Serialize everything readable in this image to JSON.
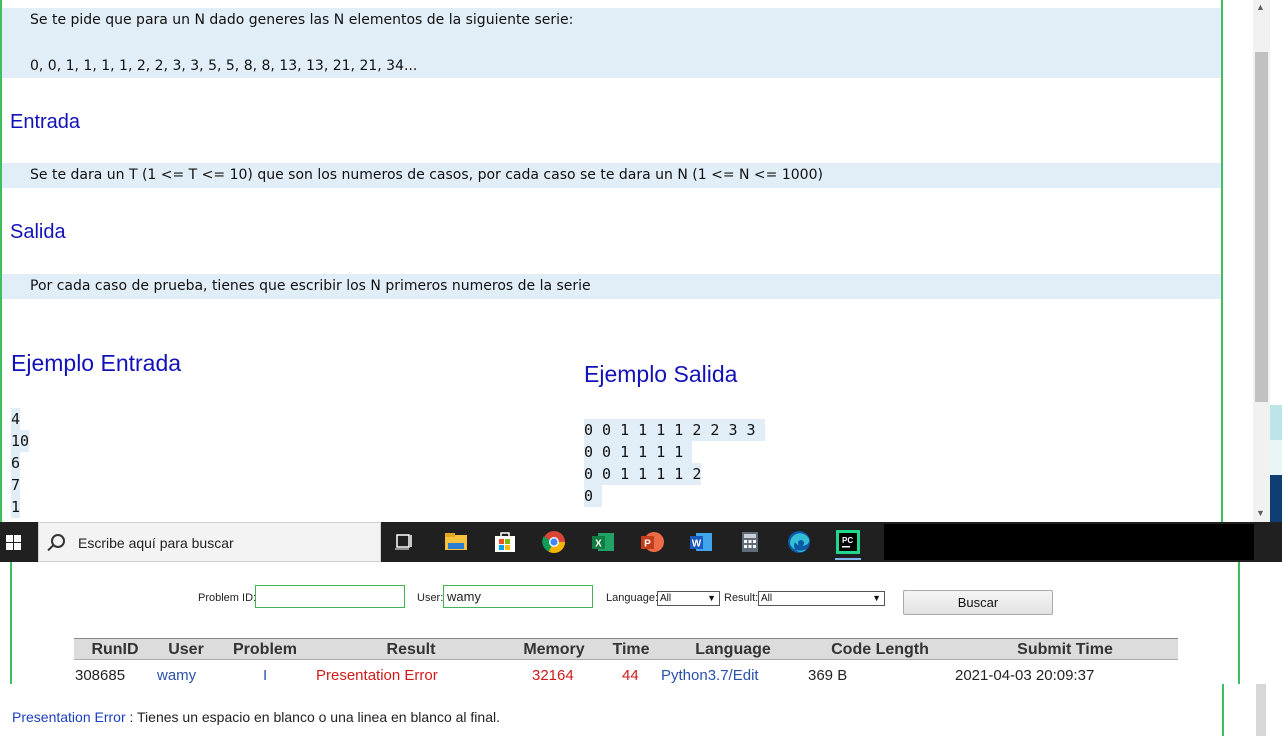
{
  "problem": {
    "intro_lines": [
      "Se te pide que para un N dado generes las N elementos de la siguiente serie:",
      "0, 0, 1, 1, 1, 1, 2, 2, 3, 3, 5, 5, 8, 8, 13, 13, 21, 21, 34..."
    ],
    "input_heading": "Entrada",
    "input_text": "Se te dara un T (1 <= T <= 10) que son los numeros de casos, por cada caso se te dara un N (1 <= N <= 1000)",
    "output_heading": "Salida",
    "output_text": "Por cada caso de prueba, tienes que escribir los N primeros numeros de la serie",
    "sample_input_heading": "Ejemplo Entrada",
    "sample_input_lines": [
      "4",
      "10",
      "6",
      "7",
      "1"
    ],
    "sample_output_heading": "Ejemplo Salida",
    "sample_output_lines": [
      "0 0 1 1 1 1 2 2 3 3 ",
      "0 0 1 1 1 1 ",
      "0 0 1 1 1 1 2",
      "0 "
    ]
  },
  "taskbar": {
    "search_placeholder": "Escribe aquí para buscar",
    "icons": [
      "windows-start-icon",
      "task-view-icon",
      "file-explorer-icon",
      "store-icon",
      "chrome-icon",
      "excel-icon",
      "powerpoint-icon",
      "word-icon",
      "calculator-icon",
      "edge-icon",
      "pycharm-icon"
    ],
    "pycharm_label": "PC",
    "excel_label": "X",
    "powerpoint_label": "P",
    "word_label": "W"
  },
  "filter": {
    "problem_id_label": "Problem ID:",
    "problem_id_value": "",
    "user_label": "User:",
    "user_value": "wamy",
    "language_label": "Language:",
    "language_value": "All",
    "result_label": "Result:",
    "result_value": "All",
    "search_button": "Buscar"
  },
  "status_table": {
    "columns": [
      "RunID",
      "User",
      "Problem",
      "Result",
      "Memory",
      "Time",
      "Language",
      "Code Length",
      "Submit Time"
    ],
    "rows": [
      {
        "run_id": "308685",
        "user": "wamy",
        "problem": "I",
        "result": "Presentation Error",
        "memory": "32164",
        "time": "44",
        "language": "Python3.7/Edit",
        "code_length": "369 B",
        "submit_time": "2021-04-03 20:09:37"
      }
    ]
  },
  "note": {
    "keyword": "Presentation Error",
    "text": " : Tienes un espacio en blanco o una linea en blanco al final."
  },
  "colors": {
    "accent_green": "#3cbf5c",
    "heading_blue": "#1212b8",
    "highlight_bg": "#e2eef7",
    "error_red": "#d01b1b",
    "link_blue": "#2a51a8"
  }
}
